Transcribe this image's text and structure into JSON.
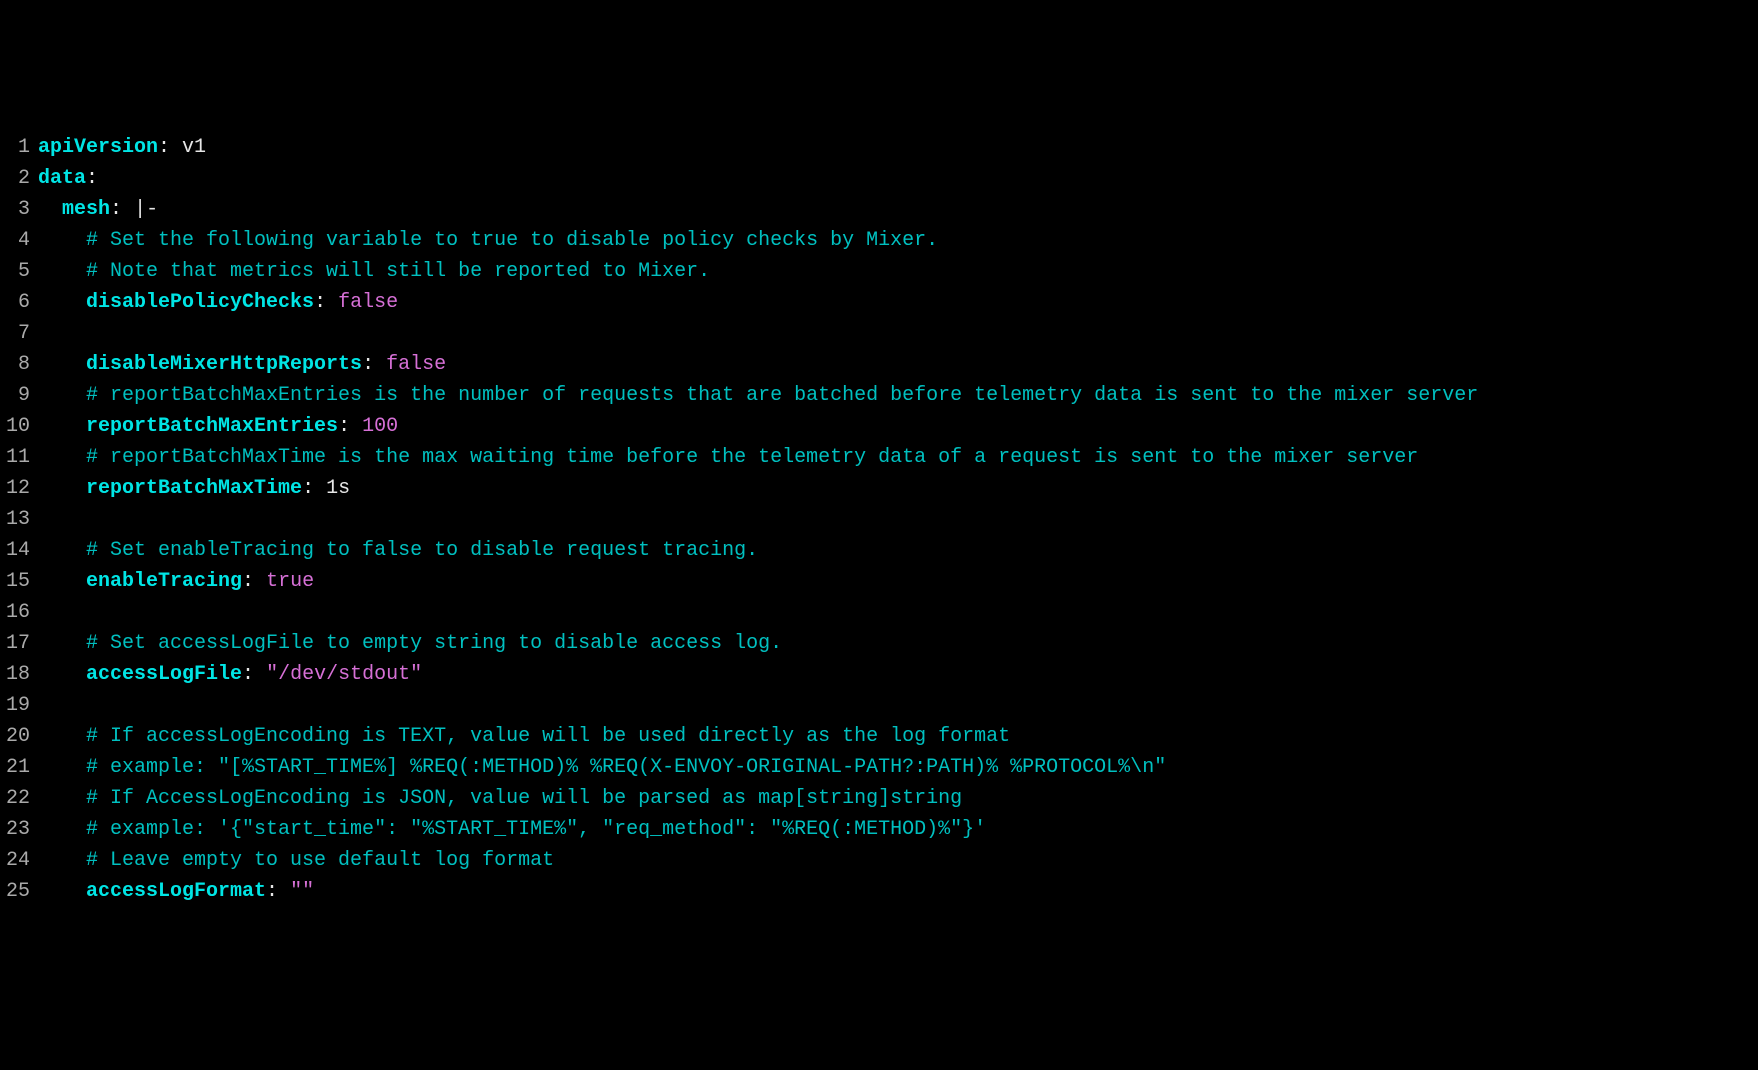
{
  "lines": [
    {
      "n": "1",
      "tokens": [
        {
          "c": "key",
          "t": "apiVersion"
        },
        {
          "c": "colon",
          "t": ":"
        },
        {
          "c": "plain",
          "t": " v1"
        }
      ]
    },
    {
      "n": "2",
      "tokens": [
        {
          "c": "key",
          "t": "data"
        },
        {
          "c": "colon",
          "t": ":"
        }
      ]
    },
    {
      "n": "3",
      "tokens": [
        {
          "c": "plain",
          "t": "  "
        },
        {
          "c": "key",
          "t": "mesh"
        },
        {
          "c": "colon",
          "t": ":"
        },
        {
          "c": "plain",
          "t": " "
        },
        {
          "c": "pipe",
          "t": "|-"
        }
      ]
    },
    {
      "n": "4",
      "tokens": [
        {
          "c": "plain",
          "t": "    "
        },
        {
          "c": "comment",
          "t": "# Set the following variable to true to disable policy checks by Mixer."
        }
      ]
    },
    {
      "n": "5",
      "tokens": [
        {
          "c": "plain",
          "t": "    "
        },
        {
          "c": "comment",
          "t": "# Note that metrics will still be reported to Mixer."
        }
      ]
    },
    {
      "n": "6",
      "tokens": [
        {
          "c": "plain",
          "t": "    "
        },
        {
          "c": "key",
          "t": "disablePolicyChecks"
        },
        {
          "c": "colon",
          "t": ":"
        },
        {
          "c": "plain",
          "t": " "
        },
        {
          "c": "boolval",
          "t": "false"
        }
      ]
    },
    {
      "n": "7",
      "tokens": []
    },
    {
      "n": "8",
      "tokens": [
        {
          "c": "plain",
          "t": "    "
        },
        {
          "c": "key",
          "t": "disableMixerHttpReports"
        },
        {
          "c": "colon",
          "t": ":"
        },
        {
          "c": "plain",
          "t": " "
        },
        {
          "c": "boolval",
          "t": "false"
        }
      ]
    },
    {
      "n": "9",
      "tokens": [
        {
          "c": "plain",
          "t": "    "
        },
        {
          "c": "comment",
          "t": "# reportBatchMaxEntries is the number of requests that are batched before telemetry data is sent to the mixer server"
        }
      ]
    },
    {
      "n": "10",
      "tokens": [
        {
          "c": "plain",
          "t": "    "
        },
        {
          "c": "key",
          "t": "reportBatchMaxEntries"
        },
        {
          "c": "colon",
          "t": ":"
        },
        {
          "c": "plain",
          "t": " "
        },
        {
          "c": "numval",
          "t": "100"
        }
      ]
    },
    {
      "n": "11",
      "tokens": [
        {
          "c": "plain",
          "t": "    "
        },
        {
          "c": "comment",
          "t": "# reportBatchMaxTime is the max waiting time before the telemetry data of a request is sent to the mixer server"
        }
      ]
    },
    {
      "n": "12",
      "tokens": [
        {
          "c": "plain",
          "t": "    "
        },
        {
          "c": "key",
          "t": "reportBatchMaxTime"
        },
        {
          "c": "colon",
          "t": ":"
        },
        {
          "c": "plain",
          "t": " 1s"
        }
      ]
    },
    {
      "n": "13",
      "tokens": []
    },
    {
      "n": "14",
      "tokens": [
        {
          "c": "plain",
          "t": "    "
        },
        {
          "c": "comment",
          "t": "# Set enableTracing to false to disable request tracing."
        }
      ]
    },
    {
      "n": "15",
      "tokens": [
        {
          "c": "plain",
          "t": "    "
        },
        {
          "c": "key",
          "t": "enableTracing"
        },
        {
          "c": "colon",
          "t": ":"
        },
        {
          "c": "plain",
          "t": " "
        },
        {
          "c": "boolval",
          "t": "true"
        }
      ]
    },
    {
      "n": "16",
      "tokens": []
    },
    {
      "n": "17",
      "tokens": [
        {
          "c": "plain",
          "t": "    "
        },
        {
          "c": "comment",
          "t": "# Set accessLogFile to empty string to disable access log."
        }
      ]
    },
    {
      "n": "18",
      "tokens": [
        {
          "c": "plain",
          "t": "    "
        },
        {
          "c": "key",
          "t": "accessLogFile"
        },
        {
          "c": "colon",
          "t": ":"
        },
        {
          "c": "plain",
          "t": " "
        },
        {
          "c": "strval",
          "t": "\"/dev/stdout\""
        }
      ]
    },
    {
      "n": "19",
      "tokens": []
    },
    {
      "n": "20",
      "tokens": [
        {
          "c": "plain",
          "t": "    "
        },
        {
          "c": "comment",
          "t": "# If accessLogEncoding is TEXT, value will be used directly as the log format"
        }
      ]
    },
    {
      "n": "21",
      "tokens": [
        {
          "c": "plain",
          "t": "    "
        },
        {
          "c": "comment",
          "t": "# example: \"[%START_TIME%] %REQ(:METHOD)% %REQ(X-ENVOY-ORIGINAL-PATH?:PATH)% %PROTOCOL%\\n\""
        }
      ]
    },
    {
      "n": "22",
      "tokens": [
        {
          "c": "plain",
          "t": "    "
        },
        {
          "c": "comment",
          "t": "# If AccessLogEncoding is JSON, value will be parsed as map[string]string"
        }
      ]
    },
    {
      "n": "23",
      "tokens": [
        {
          "c": "plain",
          "t": "    "
        },
        {
          "c": "comment",
          "t": "# example: '{\"start_time\": \"%START_TIME%\", \"req_method\": \"%REQ(:METHOD)%\"}'"
        }
      ]
    },
    {
      "n": "24",
      "tokens": [
        {
          "c": "plain",
          "t": "    "
        },
        {
          "c": "comment",
          "t": "# Leave empty to use default log format"
        }
      ]
    },
    {
      "n": "25",
      "tokens": [
        {
          "c": "plain",
          "t": "    "
        },
        {
          "c": "key",
          "t": "accessLogFormat"
        },
        {
          "c": "colon",
          "t": ":"
        },
        {
          "c": "plain",
          "t": " "
        },
        {
          "c": "strval",
          "t": "\"\""
        }
      ]
    }
  ]
}
